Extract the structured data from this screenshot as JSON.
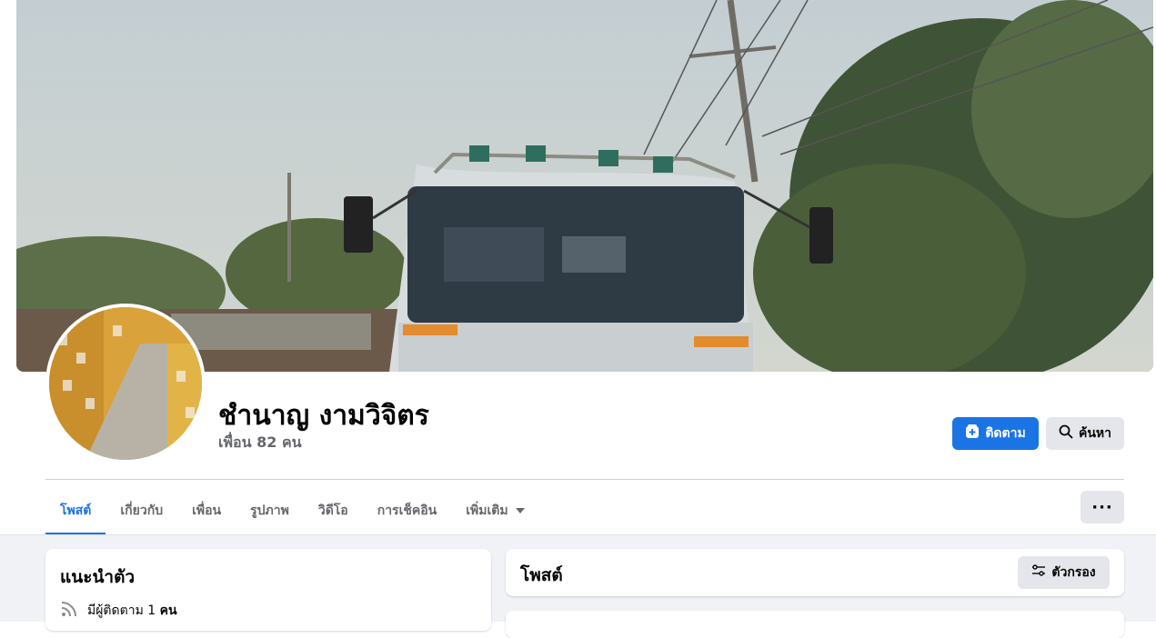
{
  "profile": {
    "name": "ชำนาญ งามวิจิตร",
    "friends_text": "เพื่อน 82 คน"
  },
  "actions": {
    "follow_label": "ติดตาม",
    "search_label": "ค้นหา",
    "more_label": "···"
  },
  "tabs": [
    {
      "label": "โพสต์",
      "active": true
    },
    {
      "label": "เกี่ยวกับ"
    },
    {
      "label": "เพื่อน"
    },
    {
      "label": "รูปภาพ"
    },
    {
      "label": "วิดีโอ"
    },
    {
      "label": "การเช็คอิน"
    },
    {
      "label": "เพิ่มเติม"
    }
  ],
  "intro": {
    "title": "แนะนำตัว",
    "followers_prefix": "มีผู้ติดตาม 1 ",
    "followers_suffix": "คน"
  },
  "posts": {
    "title": "โพสต์",
    "filter_label": "ตัวกรอง"
  },
  "colors": {
    "accent": "#1b74e4",
    "button_gray": "#e4e6eb",
    "background": "#f0f2f5",
    "secondary_text": "#65676b"
  },
  "icons": {
    "follow": "follow-add-icon",
    "search": "search-icon",
    "filter": "sliders-icon",
    "followers": "rss-icon",
    "more": "ellipsis-icon",
    "dropdown": "caret-down-icon"
  }
}
